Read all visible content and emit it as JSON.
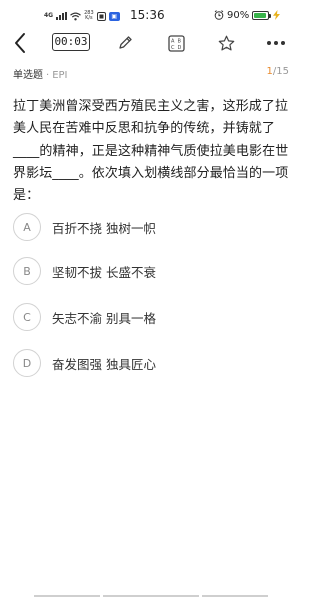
{
  "status_bar": {
    "network": "4G",
    "net_speed_value": "283",
    "net_speed_unit": "K/s",
    "time": "15:36",
    "battery_percent": "90%",
    "battery_level": 0.9
  },
  "toolbar": {
    "timer": "00:03"
  },
  "meta": {
    "question_type": "单选题",
    "separator": "·",
    "source": "EPI",
    "current": "1",
    "total": "/15"
  },
  "question": {
    "text": "拉丁美洲曾深受西方殖民主义之害，这形成了拉美人民在苦难中反思和抗争的传统，并铸就了____的精神，正是这种精神气质使拉美电影在世界影坛____。依次填入划横线部分最恰当的一项是："
  },
  "options": [
    {
      "letter": "A",
      "text": "百折不挠 独树一帜"
    },
    {
      "letter": "B",
      "text": "坚韧不拔 长盛不衰"
    },
    {
      "letter": "C",
      "text": "矢志不渝 别具一格"
    },
    {
      "letter": "D",
      "text": "奋发图强 独具匠心"
    }
  ],
  "colors": {
    "accent": "#e88a2e",
    "battery": "#38b34a",
    "badge": "#2a63e0"
  }
}
